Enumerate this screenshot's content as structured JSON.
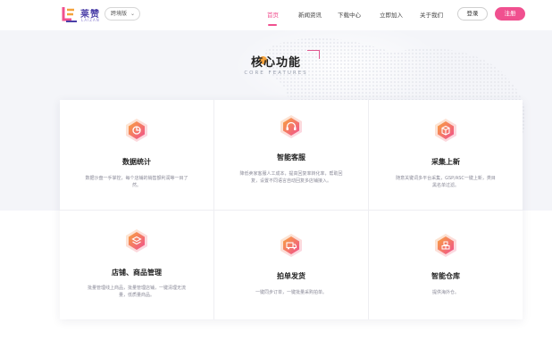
{
  "brand": {
    "name": "莱赞",
    "subtitle": "LAIZAN"
  },
  "region_select": {
    "value": "跨境版"
  },
  "nav": [
    {
      "label": "首页",
      "active": true
    },
    {
      "label": "新闻资讯",
      "active": false
    },
    {
      "label": "下载中心",
      "active": false
    },
    {
      "label": "立即加入",
      "active": false
    },
    {
      "label": "关于我们",
      "active": false
    }
  ],
  "auth": {
    "login_label": "登录",
    "register_label": "注册"
  },
  "section": {
    "title": "核心功能",
    "subtitle": "CORE FEATURES"
  },
  "features": [
    {
      "icon": "chart-icon",
      "title": "数据统计",
      "desc": "数据沙盘一手掌控，每个店铺的销售额利润等一目了然。"
    },
    {
      "icon": "headset-icon",
      "title": "智能客服",
      "desc": "降低卖家客服人工成本，提高回复率转化率，帮助回复，设置不同语言自动回复多店铺接入。"
    },
    {
      "icon": "box-icon",
      "title": "采集上新",
      "desc": "随意关键词多平台采集，GSP/ASC一键上新，类目黑名单过滤。"
    },
    {
      "icon": "layers-icon",
      "title": "店铺、商品管理",
      "desc": "批量管理线上商品，批量管理店铺，一键清理无流量，低质量商品。"
    },
    {
      "icon": "truck-icon",
      "title": "拍单发货",
      "desc": "一键同步订单，一键批量采购拍单。"
    },
    {
      "icon": "warehouse-icon",
      "title": "智能仓库",
      "desc": "提供海外仓。"
    }
  ],
  "colors": {
    "accent": "#f0508f",
    "brand": "#4b3fa8",
    "band": "#f4f5f9"
  }
}
